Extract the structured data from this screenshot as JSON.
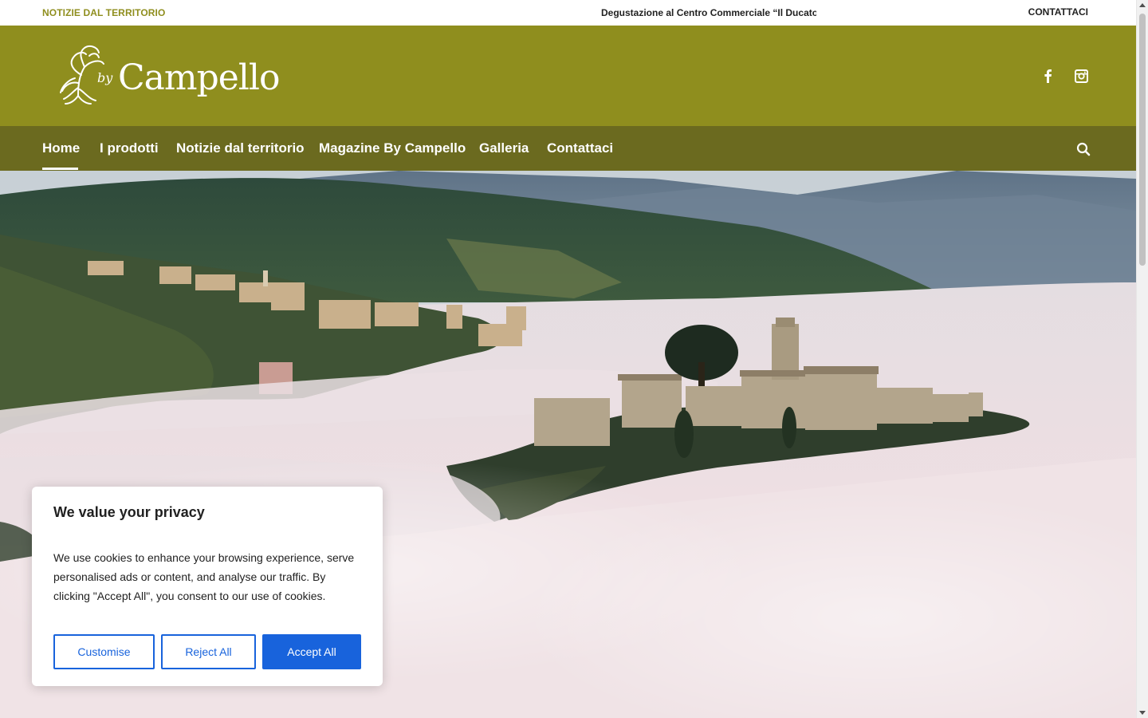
{
  "topbar": {
    "category_label": "NOTIZIE DAL TERRITORIO",
    "ticker_text": "Degustazione al Centro Commerciale “Il Ducato” d",
    "contact_label": "CONTATTACI"
  },
  "header": {
    "logo_by": "by",
    "logo_word": "Campello",
    "social": [
      "facebook-icon",
      "instagram-icon"
    ]
  },
  "nav": {
    "items": [
      {
        "label": "Home",
        "active": true
      },
      {
        "label": "I prodotti"
      },
      {
        "label": "Notizie dal territorio"
      },
      {
        "label": "Magazine By Campello"
      },
      {
        "label": "Galleria"
      },
      {
        "label": "Contattaci"
      }
    ],
    "search_icon": "search-icon"
  },
  "colors": {
    "header": "#8f8e1e",
    "nav": "#6b6a1f",
    "accent_blue": "#1863dc"
  },
  "cookie": {
    "title": "We value your privacy",
    "body": "We use cookies to enhance your browsing experience, serve personalised ads or content, and analyse our traffic. By clicking \"Accept All\", you consent to our use of cookies.",
    "customise": "Customise",
    "reject": "Reject All",
    "accept": "Accept All"
  }
}
